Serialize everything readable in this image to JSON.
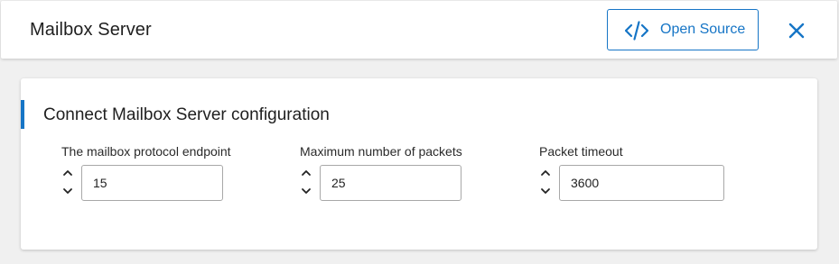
{
  "header": {
    "title": "Mailbox Server",
    "open_source_label": "Open Source",
    "open_source_icon": "code-icon",
    "close_icon": "close-icon"
  },
  "section": {
    "title": "Connect Mailbox Server configuration",
    "accent_color": "#1675c6",
    "fields": [
      {
        "label": "The mailbox protocol endpoint",
        "value": "15"
      },
      {
        "label": "Maximum number of packets",
        "value": "25"
      },
      {
        "label": "Packet timeout",
        "value": "3600"
      }
    ]
  },
  "colors": {
    "accent": "#1675c6",
    "background": "#f0f0f0",
    "card": "#ffffff"
  }
}
